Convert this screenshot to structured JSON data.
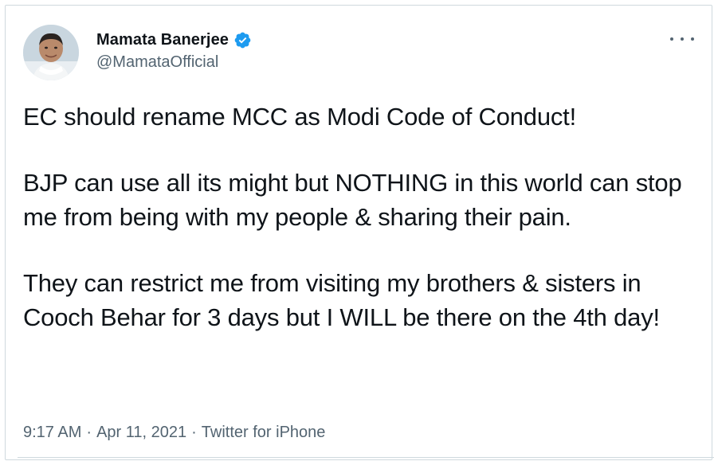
{
  "author": {
    "name": "Mamata Banerjee",
    "handle": "@MamataOfficial",
    "verified": true,
    "verified_icon": "verified-badge-icon",
    "avatar_icon": "avatar-photo"
  },
  "tweet": {
    "paragraphs": [
      "EC should rename MCC as Modi Code of Conduct!",
      "BJP can use all its might but NOTHING in this world can stop me from being with my people & sharing their pain.",
      "They can restrict me from visiting my brothers & sisters in Cooch Behar for 3 days but I WILL be there on the 4th day!"
    ]
  },
  "meta": {
    "time": "9:17 AM",
    "separator": "·",
    "date": "Apr 11, 2021",
    "source": "Twitter for iPhone"
  },
  "colors": {
    "text": "#0f1419",
    "secondary": "#536471",
    "verified": "#1d9bf0",
    "border": "#cfd9de"
  }
}
